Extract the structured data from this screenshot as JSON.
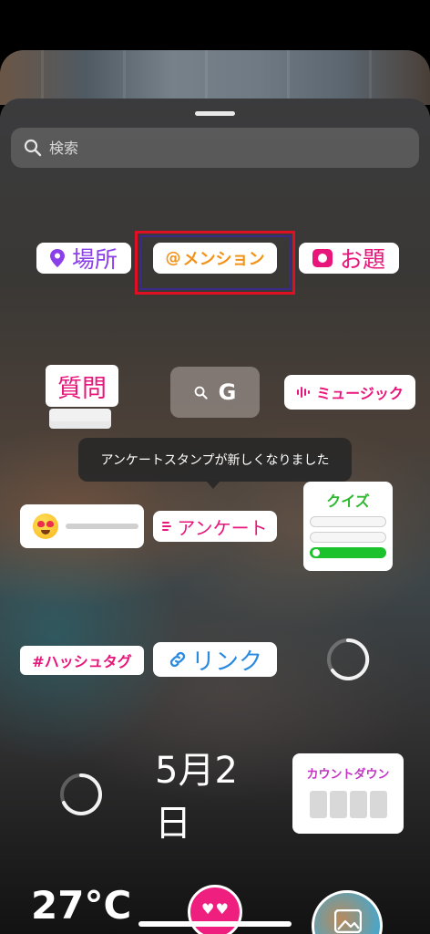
{
  "search": {
    "placeholder": "検索"
  },
  "stickers": {
    "location": "場所",
    "mention_at": "@",
    "mention": "メンション",
    "questions_prompt": "お題",
    "question": "質問",
    "gif_letter": "G",
    "music": "ミュージック",
    "poll_tooltip": "アンケートスタンプが新しくなりました",
    "poll": "アンケート",
    "quiz": "クイズ",
    "hashtag": "#ハッシュタグ",
    "link": "リンク",
    "date": "5月2日",
    "countdown": "カウントダウン"
  },
  "bottom": {
    "temperature": "27°C"
  },
  "colors": {
    "highlight_box": "#e01024",
    "mention": "#f39218",
    "pink": "#e8157a",
    "purple": "#8b3fe8",
    "quiz_green": "#2fb82f",
    "link_blue": "#2a8ae0"
  }
}
